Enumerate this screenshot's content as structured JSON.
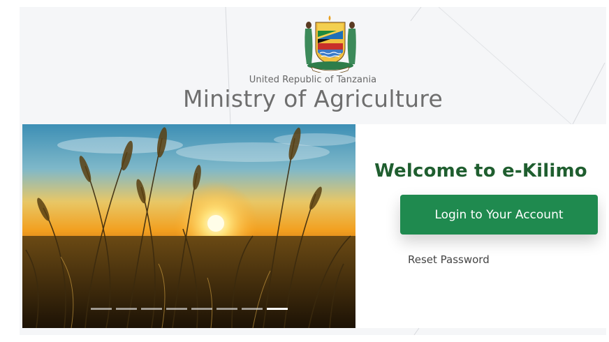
{
  "header": {
    "subtitle": "United Republic of Tanzania",
    "title": "Ministry of Agriculture",
    "emblem_icon": "tanzania-coat-of-arms-icon"
  },
  "slider": {
    "image": "sunset-wheat-field",
    "slide_count": 8,
    "active_slide": 8
  },
  "login": {
    "welcome": "Welcome to e-Kilimo",
    "login_button": "Login to Your Account",
    "reset_link": "Reset Password"
  },
  "colors": {
    "brand_green": "#1f8a4f",
    "welcome_green": "#1f5e2f",
    "panel_bg": "#f5f6f8"
  }
}
